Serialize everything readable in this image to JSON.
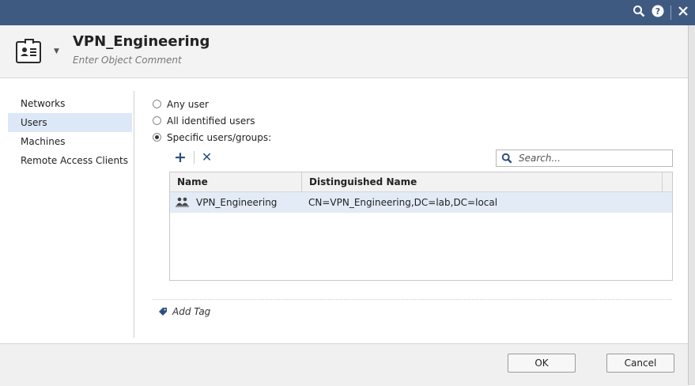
{
  "object": {
    "title": "VPN_Engineering",
    "comment_placeholder": "Enter Object Comment"
  },
  "nav": {
    "items": [
      {
        "label": "Networks",
        "active": false
      },
      {
        "label": "Users",
        "active": true
      },
      {
        "label": "Machines",
        "active": false
      },
      {
        "label": "Remote Access Clients",
        "active": false
      }
    ]
  },
  "user_options": [
    {
      "label": "Any user",
      "selected": false
    },
    {
      "label": "All identified users",
      "selected": false
    },
    {
      "label": "Specific users/groups:",
      "selected": true
    }
  ],
  "search": {
    "placeholder": "Search..."
  },
  "table": {
    "columns": [
      "Name",
      "Distinguished Name"
    ],
    "rows": [
      {
        "name": "VPN_Engineering",
        "dn": "CN=VPN_Engineering,DC=lab,DC=local"
      }
    ]
  },
  "add_tag_label": "Add Tag",
  "buttons": {
    "ok": "OK",
    "cancel": "Cancel"
  },
  "icons": {
    "titlebar": [
      "search-icon",
      "help-icon",
      "close-icon"
    ],
    "object": "id-card-icon",
    "group": "user-group-icon",
    "tag": "tag-icon"
  },
  "colors": {
    "titlebar": "#3f5a80",
    "accent": "#2a4f82",
    "selected_row": "#e3ebf6",
    "active_nav": "#dce8f7"
  }
}
